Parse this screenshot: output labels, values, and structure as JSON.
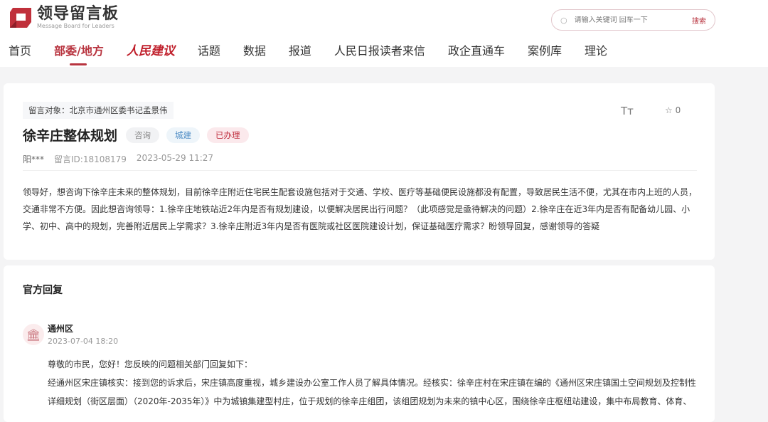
{
  "header": {
    "logo_cn": "领导留言板",
    "logo_en": "Message Board for Leaders",
    "search_placeholder": "请输入关键词 回车一下",
    "search_button": "搜索"
  },
  "nav": [
    "首页",
    "部委/地方",
    "人民建议",
    "话题",
    "数据",
    "报道",
    "人民日报读者来信",
    "政企直通车",
    "案例库",
    "理论"
  ],
  "message": {
    "target": "留言对象：北京市通州区委书记孟景伟",
    "title": "徐辛庄整体规划",
    "tags": [
      "咨询",
      "城建",
      "已办理"
    ],
    "author": "阳***",
    "id": "留言ID:18108179",
    "time": "2023-05-29 11:27",
    "font_icon_label": "Tт",
    "favorite_count": "0",
    "body_lines": [
      "领导好，想咨询下徐辛庄未来的整体规划，目前徐辛庄附近住宅民生配套设施包括对于交通、学校、医疗等基础便民设施都没有配置，导致居民生活不便，尤其在市内上班的人员，",
      "交通非常不方便。因此想咨询领导：1.徐辛庄地铁站近2年内是否有规划建设，以便解决居民出行问题？（此项感觉是亟待解决的问题）2.徐辛庄在近3年内是否有配备幼儿园、小",
      "学、初中、高中的规划，完善附近居民上学需求？3.徐辛庄附近3年内是否有医院或社区医院建设计划，保证基础医疗需求？盼领导回复，感谢领导的答疑"
    ]
  },
  "reply": {
    "section_title": "官方回复",
    "department": "通州区",
    "time": "2023-07-04 18:20",
    "lines": [
      "尊敬的市民，您好！您反映的问题相关部门回复如下：",
      "经通州区宋庄镇核实：接到您的诉求后，宋庄镇高度重视，城乡建设办公室工作人员了解具体情况。经核实：徐辛庄村在宋庄镇在编的《通州区宋庄镇国土空间规划及控制性",
      "详细规划（街区层面）（2020年-2035年）》中为城镇集建型村庄，位于规划的徐辛庄组团，该组团规划为未来的镇中心区，围绕徐辛庄枢纽站建设，集中布局教育、体育、"
    ]
  },
  "colors": {
    "accent": "#b8343f",
    "tag_blue": "#4a8ac4",
    "tag_red": "#c03040"
  }
}
